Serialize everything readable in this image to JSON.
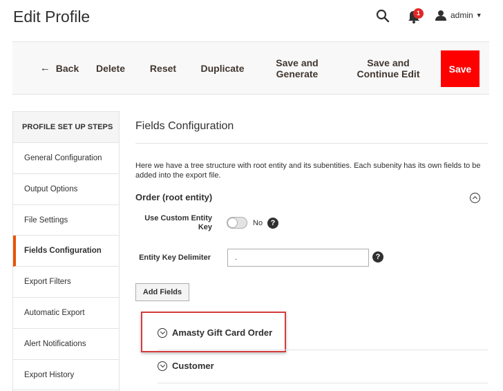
{
  "header": {
    "title": "Edit Profile",
    "notifications_count": "1",
    "user_name": "admin",
    "icons": [
      "search-icon",
      "bell-icon",
      "user-icon",
      "caret-down-icon"
    ]
  },
  "actions": {
    "back": "Back",
    "delete": "Delete",
    "reset": "Reset",
    "duplicate": "Duplicate",
    "save_generate": "Save and Generate",
    "save_continue": "Save and Continue Edit",
    "save": "Save"
  },
  "sidebar": {
    "heading": "PROFILE SET UP STEPS",
    "items": [
      {
        "label": "General Configuration"
      },
      {
        "label": "Output Options"
      },
      {
        "label": "File Settings"
      },
      {
        "label": "Fields Configuration"
      },
      {
        "label": "Export Filters"
      },
      {
        "label": "Automatic Export"
      },
      {
        "label": "Alert Notifications"
      },
      {
        "label": "Export History"
      }
    ],
    "active_index": 3
  },
  "main": {
    "section_title": "Fields Configuration",
    "description": "Here we have a tree structure with root entity and its subentities. Each subenity has its own fields to be added into the export file.",
    "entity_title": "Order (root entity)",
    "use_custom_key_label": "Use Custom Entity Key",
    "use_custom_key_value": "No",
    "delimiter_label": "Entity Key Delimiter",
    "delimiter_value": ".",
    "add_fields": "Add Fields",
    "subentities": [
      {
        "label": "Amasty Gift Card Order"
      },
      {
        "label": "Customer"
      }
    ]
  },
  "colors": {
    "accent": "#eb5202",
    "save_button": "#ff0000",
    "highlight_box": "#d33c3c",
    "badge": "#e22626"
  }
}
